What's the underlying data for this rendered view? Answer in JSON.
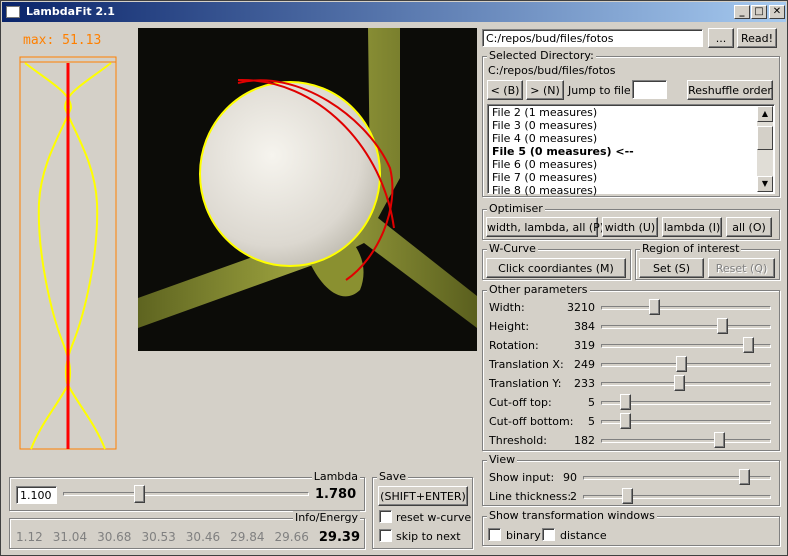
{
  "window": {
    "title": "LambdaFit 2.1",
    "minimize": "_",
    "maximize": "□",
    "close": "✕"
  },
  "curve_panel": {
    "max_label": "max: 51.13",
    "color_curve": "#ffff00",
    "color_axis": "#ff0000",
    "color_frame": "#ff8000"
  },
  "top_bar": {
    "path_value": "C:/repos/bud/files/fotos",
    "browse_label": "...",
    "read_label": "Read!"
  },
  "selected_dir": {
    "title": "Selected Directory:",
    "path": "C:/repos/bud/files/fotos",
    "prev_label": "< (B)",
    "next_label": "> (N)",
    "jump_label": "Jump to file:",
    "jump_value": "",
    "reshuffle_label": "Reshuffle order",
    "files": [
      "File 2 (1 measures)",
      "File 3 (0 measures)",
      "File 4 (0 measures)",
      "File 5 (0 measures) <--",
      "File 6 (0 measures)",
      "File 7 (0 measures)",
      "File 8 (0 measures)"
    ],
    "selected_index": 3
  },
  "optimiser": {
    "title": "Optimiser",
    "buttons": [
      "width, lambda, all (P)",
      "width (U)",
      "lambda (I)",
      "all (O)"
    ]
  },
  "wcurve": {
    "title": "W-Curve",
    "button": "Click coordiantes (M)"
  },
  "roi": {
    "title": "Region of interest",
    "set_label": "Set (S)",
    "reset_label": "Reset (Q)"
  },
  "other_params": {
    "title": "Other parameters",
    "rows": [
      {
        "label": "Width:",
        "value": "3210",
        "level": 0.3
      },
      {
        "label": "Height:",
        "value": "384",
        "level": 0.73
      },
      {
        "label": "Rotation:",
        "value": "319",
        "level": 0.89
      },
      {
        "label": "Translation X:",
        "value": "249",
        "level": 0.47
      },
      {
        "label": "Translation Y:",
        "value": "233",
        "level": 0.46
      },
      {
        "label": "Cut-off top:",
        "value": "5",
        "level": 0.12
      },
      {
        "label": "Cut-off bottom:",
        "value": "5",
        "level": 0.12
      },
      {
        "label": "Threshold:",
        "value": "182",
        "level": 0.71
      }
    ]
  },
  "view": {
    "title": "View",
    "rows": [
      {
        "label": "Show input:",
        "value": "90",
        "level": 0.88
      },
      {
        "label": "Line thickness:",
        "value": "2",
        "level": 0.22
      }
    ]
  },
  "transform_windows": {
    "title": "Show transformation windows",
    "binary_label": "binary",
    "distance_label": "distance"
  },
  "lambda": {
    "title": "Lambda",
    "input_value": "1.100",
    "value_label": "1.780",
    "level": 0.3
  },
  "save": {
    "title": "Save",
    "button": "(SHIFT+ENTER)",
    "reset_label": "reset w-curve",
    "skip_label": "skip to next"
  },
  "info": {
    "title": "Info/Energy",
    "values": [
      "1.12",
      "31.04",
      "30.68",
      "30.53",
      "30.46",
      "29.84",
      "29.66"
    ],
    "current": "29.39"
  }
}
